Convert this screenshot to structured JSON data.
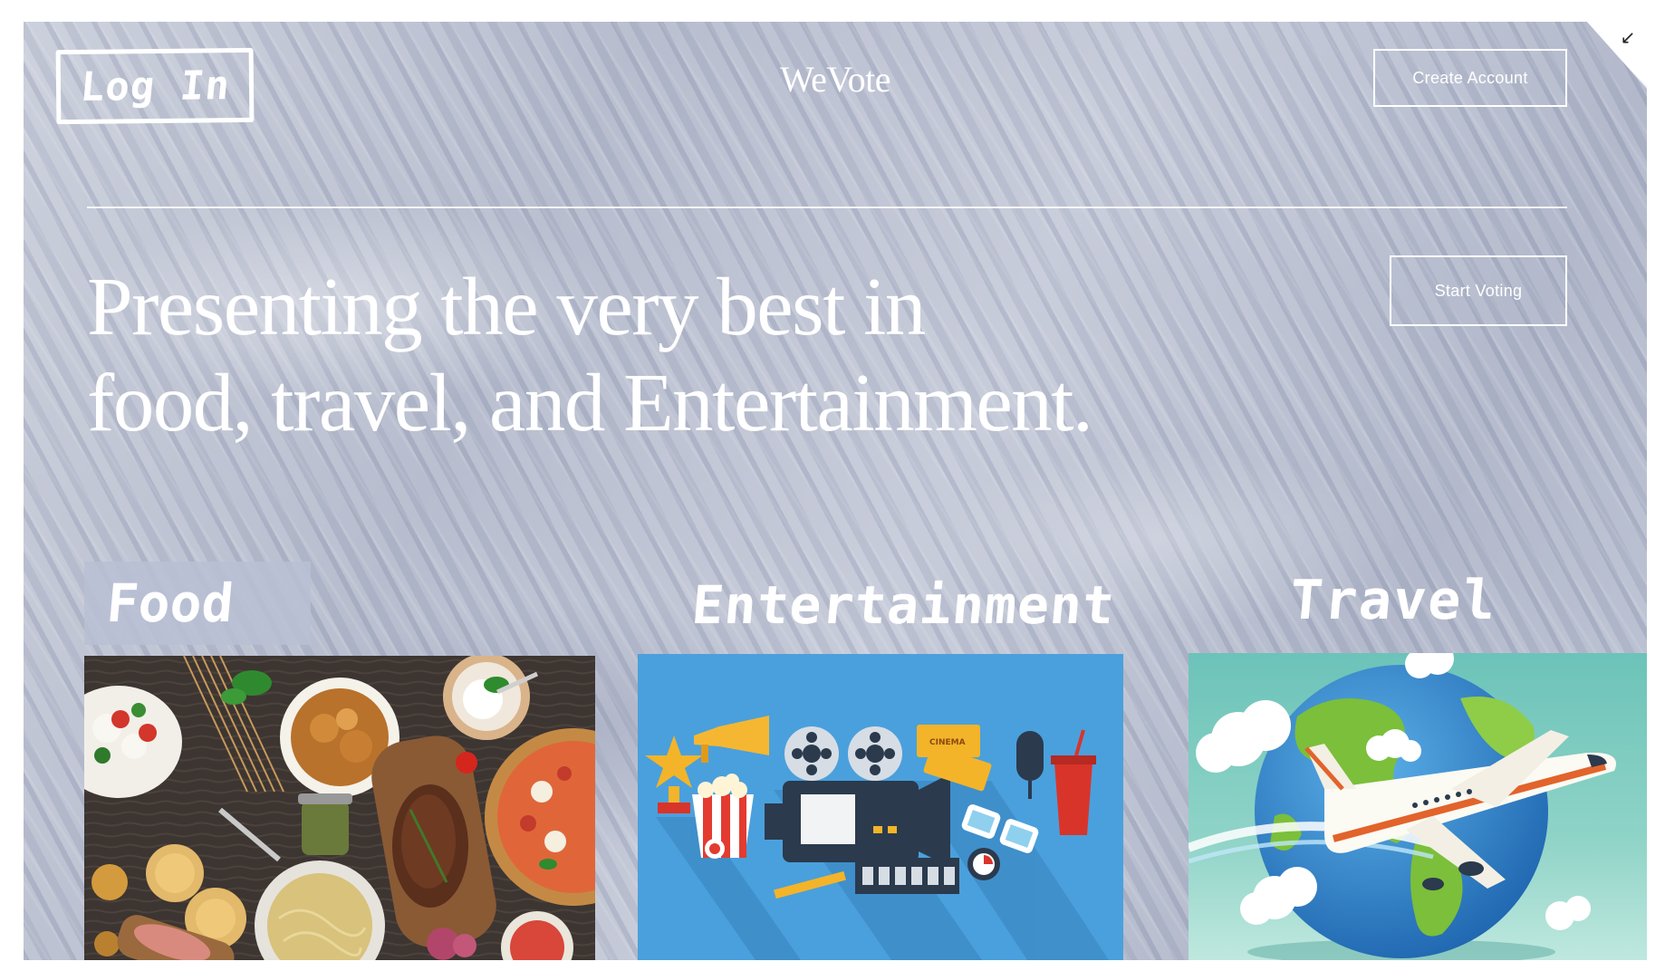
{
  "header": {
    "login_label": "Log In",
    "brand": "WeVote",
    "create_account_label": "Create Account"
  },
  "hero": {
    "headline_line1": "Presenting the very best in",
    "headline_line2": "food, travel, and Entertainment.",
    "start_voting_label": "Start Voting"
  },
  "categories": [
    {
      "label": "Food",
      "image": "food-spread-image"
    },
    {
      "label": "Entertainment",
      "image": "entertainment-icons-image"
    },
    {
      "label": "Travel",
      "image": "globe-airplane-image"
    }
  ],
  "icons": {
    "collapse": "collapse-arrow-icon"
  },
  "colors": {
    "text": "#ffffff",
    "panel": "#b8bfd1",
    "entertainment_bg": "#4aa0dc",
    "travel_bg": "#6cc3b9"
  }
}
